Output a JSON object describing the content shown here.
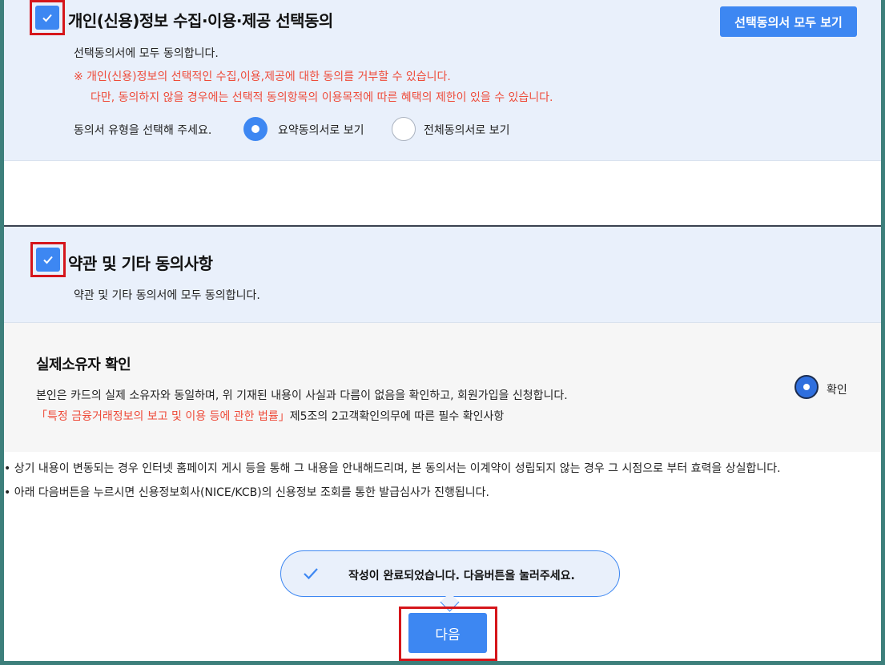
{
  "section_personal": {
    "title": "개인(신용)정보 수집·이용·제공 선택동의",
    "view_all_button": "선택동의서 모두 보기",
    "agree_all_text": "선택동의서에 모두 동의합니다.",
    "warning_line1": "※ 개인(신용)정보의 선택적인 수집,이용,제공에 대한 동의를 거부할 수 있습니다.",
    "warning_line2": "다만, 동의하지 않을 경우에는 선택적 동의항목의 이용목적에 따른 혜택의 제한이 있을 수 있습니다.",
    "type_prompt": "동의서 유형을 선택해 주세요.",
    "option_summary": "요약동의서로 보기",
    "option_full": "전체동의서로 보기",
    "selected_option": "요약동의서로 보기",
    "checked": true
  },
  "section_terms": {
    "title": "약관 및 기타 동의사항",
    "agree_all_text": "약관 및 기타 동의서에 모두 동의합니다.",
    "checked": true
  },
  "section_owner": {
    "title": "실제소유자 확인",
    "description": "본인은 카드의 실제 소유자와 동일하며, 위 기재된 내용이 사실과 다름이 없음을 확인하고, 회원가입을 신청합니다.",
    "law_ref": "「특정 금융거래정보의 보고 및 이용 등에 관한 법률」",
    "law_rest": "제5조의 2고객확인의무에 따른 필수 확인사항",
    "confirm_label": "확인"
  },
  "notices": [
    "상기 내용이 변동되는 경우 인터넷 홈페이지 게시 등을 통해 그 내용을 안내해드리며, 본 동의서는 이계약이 성립되지 않는 경우 그 시점으로 부터 효력을 상실합니다.",
    "아래 다음버튼을 누르시면 신용정보회사(NICE/KCB)의 신용정보 조회를 통한 발급심사가 진행됩니다."
  ],
  "completion_message": "작성이 완료되었습니다. 다음버튼을 눌러주세요.",
  "next_button": "다음",
  "colors": {
    "accent": "#3d87f2",
    "warning": "#ee4b3a",
    "highlight_outline": "#d5161b",
    "panel_bg": "#e9f0fb"
  }
}
